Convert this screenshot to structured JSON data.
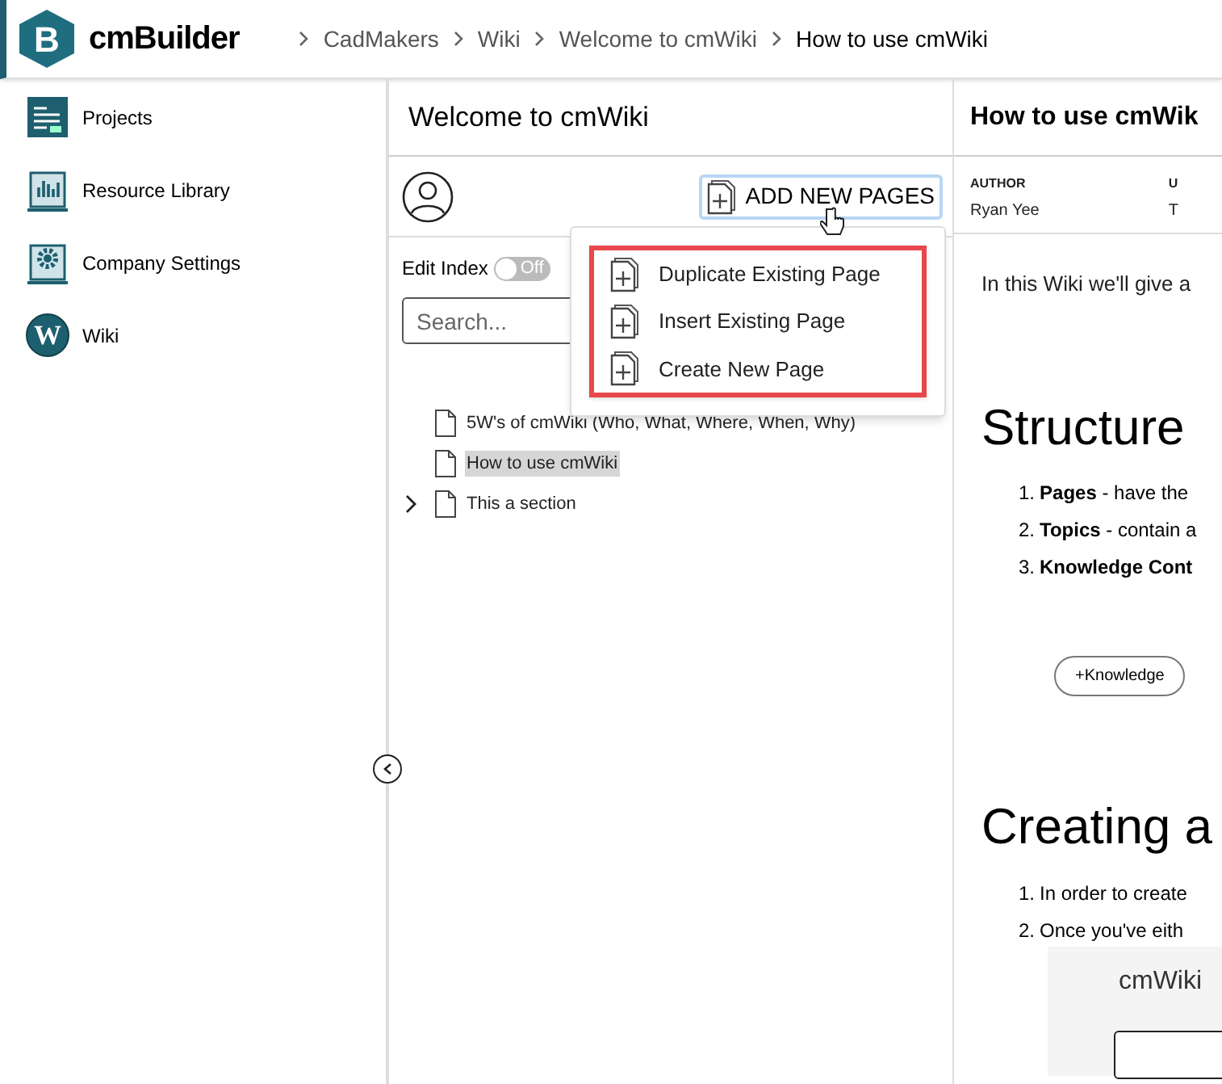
{
  "header": {
    "logo_letter": "B",
    "brand": "cmBuilder",
    "breadcrumbs": [
      {
        "label": "CadMakers",
        "current": false
      },
      {
        "label": "Wiki",
        "current": false
      },
      {
        "label": "Welcome to cmWiki",
        "current": false
      },
      {
        "label": "How to use cmWiki",
        "current": true
      }
    ]
  },
  "sidebar": {
    "items": [
      {
        "label": "Projects",
        "kind": "projects"
      },
      {
        "label": "Resource Library",
        "kind": "library"
      },
      {
        "label": "Company Settings",
        "kind": "settings"
      },
      {
        "label": "Wiki",
        "kind": "wiki",
        "icon_text": "W"
      }
    ]
  },
  "index_panel": {
    "title": "Welcome to cmWiki",
    "add_button": "ADD NEW PAGES",
    "edit_index": {
      "label": "Edit Index",
      "on": false,
      "state_text": "Off"
    },
    "search": {
      "placeholder": "Search..."
    },
    "menu": [
      {
        "label": "Duplicate Existing Page"
      },
      {
        "label": "Insert Existing Page"
      },
      {
        "label": "Create New Page"
      }
    ],
    "tree": [
      {
        "label": "5W's of cmWiki (Who, What, Where, When, Why)",
        "selected": false,
        "has_children": false
      },
      {
        "label": "How to use cmWiki",
        "selected": true,
        "has_children": false
      },
      {
        "label": "This a section",
        "selected": false,
        "has_children": true
      }
    ]
  },
  "page": {
    "title": "How to use cmWik",
    "meta": [
      {
        "label": "AUTHOR",
        "value": "Ryan Yee"
      },
      {
        "label": "U",
        "value": "T"
      }
    ],
    "intro": "In this Wiki we'll give a",
    "sections": [
      {
        "heading": "Structure",
        "items": [
          {
            "number": "1.",
            "text": "**Pages** - have the"
          },
          {
            "number": "2.",
            "text": "**Topics** - contain a"
          },
          {
            "number": "3.",
            "text": "**Knowledge Cont**"
          }
        ],
        "button": "+Knowledge"
      },
      {
        "heading": "Creating a",
        "items": [
          {
            "number": "1.",
            "text": "In order to create"
          },
          {
            "number": "2.",
            "text": "Once you've eith"
          }
        ],
        "embed_title": "cmWiki"
      }
    ]
  }
}
